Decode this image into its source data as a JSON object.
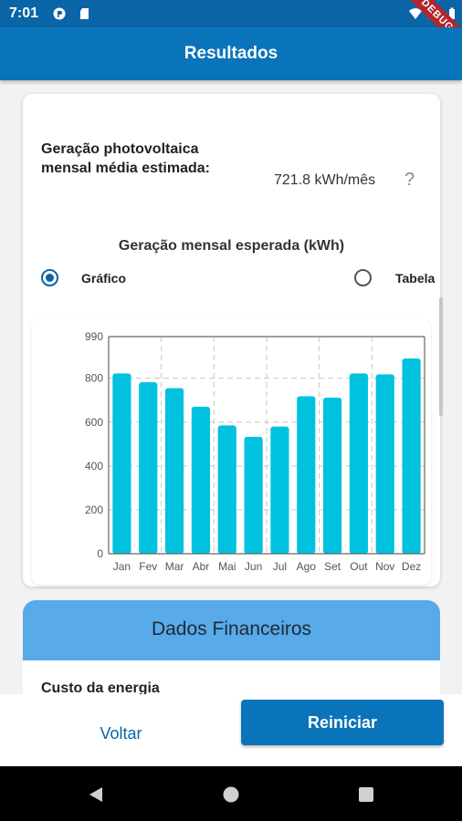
{
  "status_bar": {
    "time": "7:01",
    "debug_banner": "DEBUG"
  },
  "app_bar": {
    "title": "Resultados"
  },
  "results": {
    "generation_label": "Geração photovoltaica mensal média estimada:",
    "generation_value": "721.8 kWh/mês",
    "help_glyph": "?",
    "chart_title": "Geração mensal esperada (kWh)",
    "view_options": [
      {
        "label": "Gráfico",
        "selected": true
      },
      {
        "label": "Tabela",
        "selected": false
      }
    ]
  },
  "chart_data": {
    "type": "bar",
    "categories": [
      "Jan",
      "Fev",
      "Mar",
      "Abr",
      "Mai",
      "Jun",
      "Jul",
      "Ago",
      "Set",
      "Out",
      "Nov",
      "Dez"
    ],
    "values": [
      822,
      782,
      755,
      670,
      585,
      533,
      580,
      718,
      712,
      822,
      818,
      890
    ],
    "ylim": [
      0,
      990
    ],
    "yticks": [
      0,
      200,
      400,
      600,
      800,
      990
    ],
    "grid": true,
    "bar_color": "#00c2df"
  },
  "financial": {
    "title": "Dados Financeiros",
    "energy_cost_label": "Custo da energia"
  },
  "buttons": {
    "back": "Voltar",
    "reset": "Reiniciar"
  },
  "colors": {
    "primary": "#0a74bb",
    "accent": "#58aae8",
    "bar": "#00c2df"
  }
}
